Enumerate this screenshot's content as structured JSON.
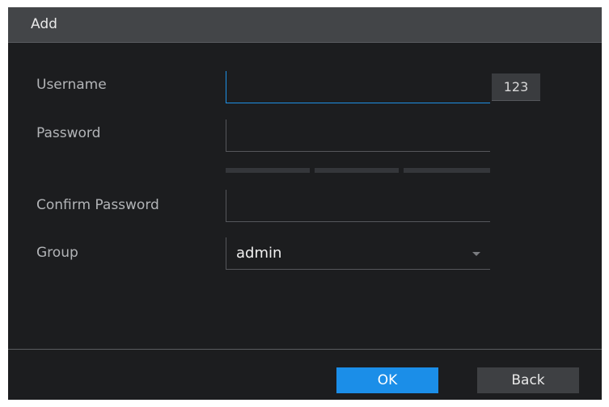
{
  "dialog": {
    "title": "Add"
  },
  "form": {
    "username_label": "Username",
    "username_value": "",
    "keyboard_button": "123",
    "password_label": "Password",
    "password_value": "",
    "confirm_label": "Confirm Password",
    "confirm_value": "",
    "group_label": "Group",
    "group_value": "admin"
  },
  "buttons": {
    "ok": "OK",
    "back": "Back"
  },
  "colors": {
    "accent": "#1b8ee8",
    "background": "#1c1d1f",
    "title_bar": "#434548"
  }
}
